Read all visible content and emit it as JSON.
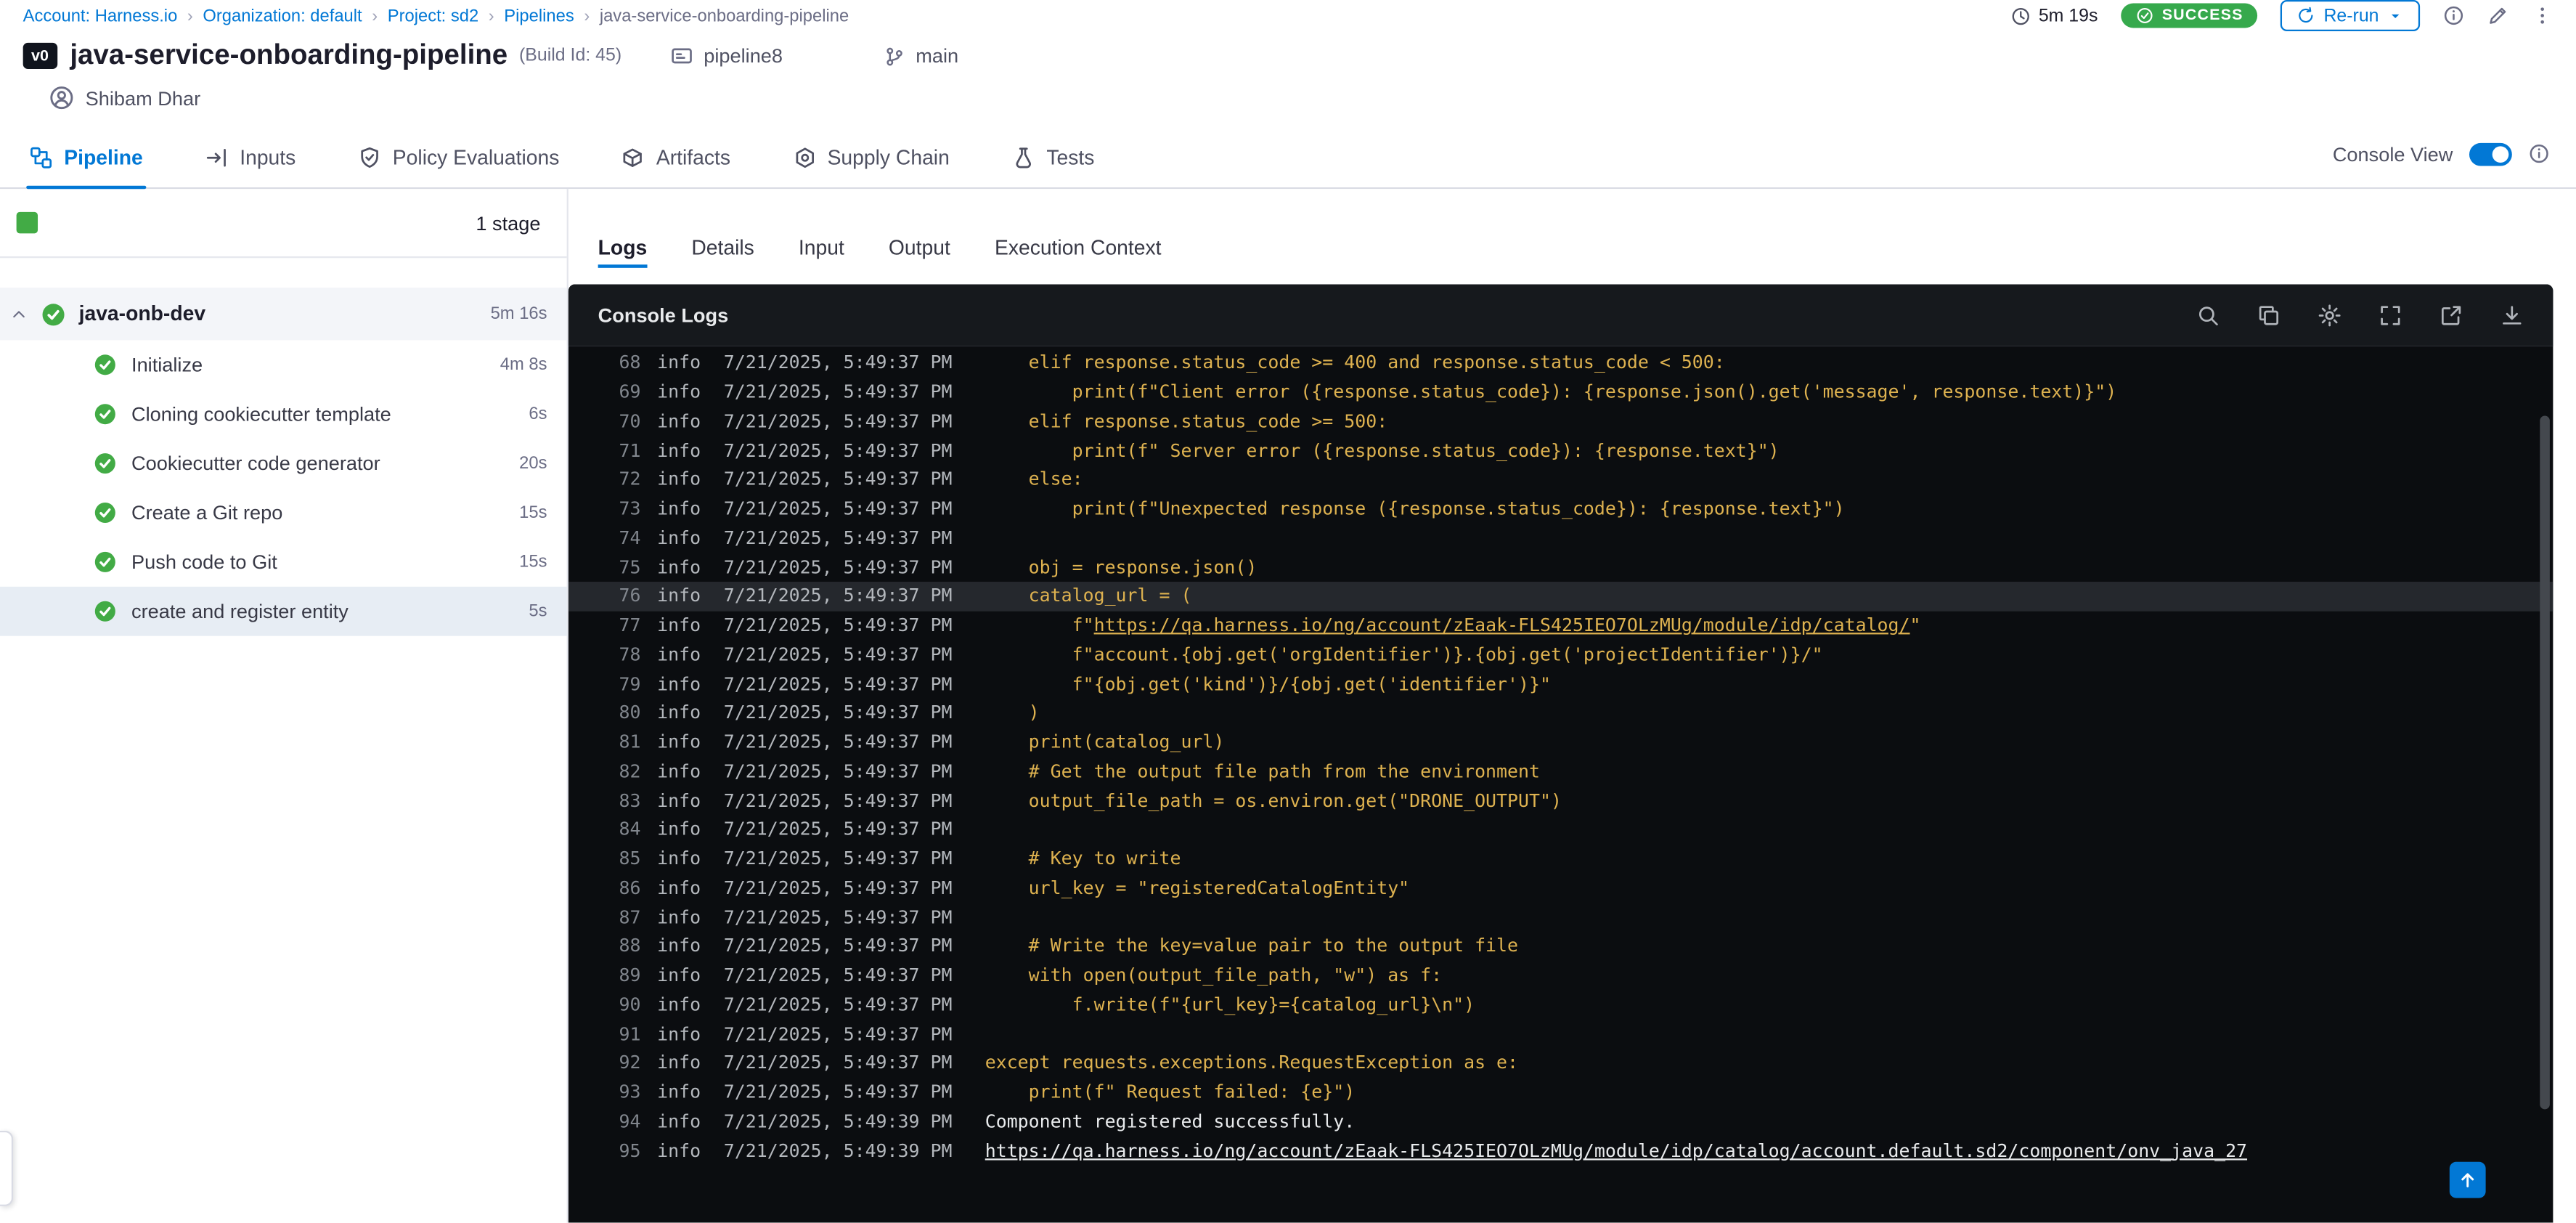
{
  "accent": "#0278d5",
  "breadcrumb": {
    "separator": "›",
    "items": [
      {
        "label": "Account: Harness.io"
      },
      {
        "label": "Organization: default"
      },
      {
        "label": "Project: sd2"
      },
      {
        "label": "Pipelines"
      },
      {
        "label": "java-service-onboarding-pipeline",
        "current": true
      }
    ]
  },
  "toolbar": {
    "duration": "5m 19s",
    "status_label": "SUCCESS",
    "status_color": "#36a94c",
    "rerun_label": "Re-run"
  },
  "header": {
    "version_badge": "v0",
    "title": "java-service-onboarding-pipeline",
    "build_id": "(Build Id: 45)",
    "pipeline_name": "pipeline8",
    "branch": "main",
    "user_name": "Shibam Dhar"
  },
  "tabs": {
    "items": [
      {
        "label": "Pipeline",
        "icon": "pipeline-icon",
        "active": true
      },
      {
        "label": "Inputs",
        "icon": "inputs-icon"
      },
      {
        "label": "Policy Evaluations",
        "icon": "policy-icon"
      },
      {
        "label": "Artifacts",
        "icon": "artifacts-icon"
      },
      {
        "label": "Supply Chain",
        "icon": "supply-chain-icon"
      },
      {
        "label": "Tests",
        "icon": "tests-icon"
      }
    ],
    "console_view_label": "Console View",
    "console_view_on": true
  },
  "stage_panel": {
    "stage_count_label": "1 stage",
    "stage_name": "java-onb-dev",
    "stage_duration": "5m 16s",
    "steps": [
      {
        "label": "Initialize",
        "duration": "4m 8s"
      },
      {
        "label": "Cloning cookiecutter template",
        "duration": "6s"
      },
      {
        "label": "Cookiecutter code generator",
        "duration": "20s"
      },
      {
        "label": "Create a Git repo",
        "duration": "15s"
      },
      {
        "label": "Push code to Git",
        "duration": "15s"
      },
      {
        "label": "create and register entity",
        "duration": "5s",
        "selected": true
      }
    ]
  },
  "log_panel": {
    "tabs": [
      {
        "label": "Logs",
        "active": true
      },
      {
        "label": "Details"
      },
      {
        "label": "Input"
      },
      {
        "label": "Output"
      },
      {
        "label": "Execution Context"
      }
    ],
    "console_title": "Console Logs",
    "actions": [
      {
        "icon": "search-icon"
      },
      {
        "icon": "copy-icon"
      },
      {
        "icon": "settings-icon"
      },
      {
        "icon": "fullscreen-icon"
      },
      {
        "icon": "open-in-new-icon"
      },
      {
        "icon": "download-icon"
      }
    ],
    "colors": {
      "code": "#deb250",
      "plain": "#e9ebed",
      "meta": "#b4b8bd",
      "line_number": "#81868d",
      "highlight_bg": "#25282d"
    },
    "lines": [
      {
        "num": "68",
        "level": "info",
        "time": "7/21/2025, 5:49:37 PM",
        "parts": [
          {
            "c": "code",
            "s": "    elif response.status_code >= 400 and response.status_code < 500:"
          }
        ]
      },
      {
        "num": "69",
        "level": "info",
        "time": "7/21/2025, 5:49:37 PM",
        "parts": [
          {
            "c": "code",
            "s": "        print(f\"Client error ({response.status_code}): {response.json().get('message', response.text)}\")"
          }
        ]
      },
      {
        "num": "70",
        "level": "info",
        "time": "7/21/2025, 5:49:37 PM",
        "parts": [
          {
            "c": "code",
            "s": "    elif response.status_code >= 500:"
          }
        ]
      },
      {
        "num": "71",
        "level": "info",
        "time": "7/21/2025, 5:49:37 PM",
        "parts": [
          {
            "c": "code",
            "s": "        print(f\" Server error ({response.status_code}): {response.text}\")"
          }
        ]
      },
      {
        "num": "72",
        "level": "info",
        "time": "7/21/2025, 5:49:37 PM",
        "parts": [
          {
            "c": "code",
            "s": "    else:"
          }
        ]
      },
      {
        "num": "73",
        "level": "info",
        "time": "7/21/2025, 5:49:37 PM",
        "parts": [
          {
            "c": "code",
            "s": "        print(f\"Unexpected response ({response.status_code}): {response.text}\")"
          }
        ]
      },
      {
        "num": "74",
        "level": "info",
        "time": "7/21/2025, 5:49:37 PM",
        "parts": []
      },
      {
        "num": "75",
        "level": "info",
        "time": "7/21/2025, 5:49:37 PM",
        "parts": [
          {
            "c": "code",
            "s": "    obj = response.json()"
          }
        ]
      },
      {
        "num": "76",
        "level": "info",
        "time": "7/21/2025, 5:49:37 PM",
        "highlight": true,
        "parts": [
          {
            "c": "code",
            "s": "    catalog_url = ("
          }
        ]
      },
      {
        "num": "77",
        "level": "info",
        "time": "7/21/2025, 5:49:37 PM",
        "parts": [
          {
            "c": "code",
            "s": "        f\""
          },
          {
            "c": "code-link",
            "s": "https://qa.harness.io/ng/account/zEaak-FLS425IEO7OLzMUg/module/idp/catalog/"
          },
          {
            "c": "code",
            "s": "\""
          }
        ]
      },
      {
        "num": "78",
        "level": "info",
        "time": "7/21/2025, 5:49:37 PM",
        "parts": [
          {
            "c": "code",
            "s": "        f\"account.{obj.get('orgIdentifier')}.{obj.get('projectIdentifier')}/\""
          }
        ]
      },
      {
        "num": "79",
        "level": "info",
        "time": "7/21/2025, 5:49:37 PM",
        "parts": [
          {
            "c": "code",
            "s": "        f\"{obj.get('kind')}/{obj.get('identifier')}\""
          }
        ]
      },
      {
        "num": "80",
        "level": "info",
        "time": "7/21/2025, 5:49:37 PM",
        "parts": [
          {
            "c": "code",
            "s": "    )"
          }
        ]
      },
      {
        "num": "81",
        "level": "info",
        "time": "7/21/2025, 5:49:37 PM",
        "parts": [
          {
            "c": "code",
            "s": "    print(catalog_url)"
          }
        ]
      },
      {
        "num": "82",
        "level": "info",
        "time": "7/21/2025, 5:49:37 PM",
        "parts": [
          {
            "c": "code",
            "s": "    # Get the output file path from the environment"
          }
        ]
      },
      {
        "num": "83",
        "level": "info",
        "time": "7/21/2025, 5:49:37 PM",
        "parts": [
          {
            "c": "code",
            "s": "    output_file_path = os.environ.get(\"DRONE_OUTPUT\")"
          }
        ]
      },
      {
        "num": "84",
        "level": "info",
        "time": "7/21/2025, 5:49:37 PM",
        "parts": []
      },
      {
        "num": "85",
        "level": "info",
        "time": "7/21/2025, 5:49:37 PM",
        "parts": [
          {
            "c": "code",
            "s": "    # Key to write"
          }
        ]
      },
      {
        "num": "86",
        "level": "info",
        "time": "7/21/2025, 5:49:37 PM",
        "parts": [
          {
            "c": "code",
            "s": "    url_key = \"registeredCatalogEntity\""
          }
        ]
      },
      {
        "num": "87",
        "level": "info",
        "time": "7/21/2025, 5:49:37 PM",
        "parts": []
      },
      {
        "num": "88",
        "level": "info",
        "time": "7/21/2025, 5:49:37 PM",
        "parts": [
          {
            "c": "code",
            "s": "    # Write the key=value pair to the output file"
          }
        ]
      },
      {
        "num": "89",
        "level": "info",
        "time": "7/21/2025, 5:49:37 PM",
        "parts": [
          {
            "c": "code",
            "s": "    with open(output_file_path, \"w\") as f:"
          }
        ]
      },
      {
        "num": "90",
        "level": "info",
        "time": "7/21/2025, 5:49:37 PM",
        "parts": [
          {
            "c": "code",
            "s": "        f.write(f\"{url_key}={catalog_url}\\n\")"
          }
        ]
      },
      {
        "num": "91",
        "level": "info",
        "time": "7/21/2025, 5:49:37 PM",
        "parts": []
      },
      {
        "num": "92",
        "level": "info",
        "time": "7/21/2025, 5:49:37 PM",
        "parts": [
          {
            "c": "code",
            "s": "except requests.exceptions.RequestException as e:"
          }
        ]
      },
      {
        "num": "93",
        "level": "info",
        "time": "7/21/2025, 5:49:37 PM",
        "parts": [
          {
            "c": "code",
            "s": "    print(f\" Request failed: {e}\")"
          }
        ]
      },
      {
        "num": "94",
        "level": "info",
        "time": "7/21/2025, 5:49:39 PM",
        "parts": [
          {
            "c": "plain",
            "s": "Component registered successfully."
          }
        ]
      },
      {
        "num": "95",
        "level": "info",
        "time": "7/21/2025, 5:49:39 PM",
        "parts": [
          {
            "c": "plain-link",
            "s": "https://qa.harness.io/ng/account/zEaak-FLS425IEO7OLzMUg/module/idp/catalog/account.default.sd2/component/onv_java_27"
          }
        ]
      }
    ]
  }
}
